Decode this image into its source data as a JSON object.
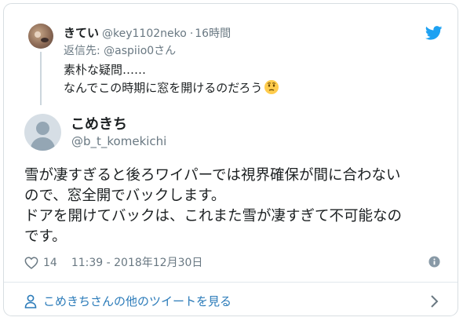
{
  "parent_tweet": {
    "name": "きてい",
    "handle": "@key1102neko",
    "separator": "·",
    "time": "16時間",
    "reply_to_label": "返信先: ",
    "reply_to_handle": "@aspiio0さん",
    "text_lines": [
      "素朴な疑問……",
      "なんでこの時期に窓を開けるのだろう"
    ],
    "emoji": "thinking-face-emoji"
  },
  "main_tweet": {
    "name": "こめきち",
    "handle": "@b_t_komekichi",
    "text_lines": [
      "雪が凄すぎると後ろワイパーでは視界確保が間に合わない",
      "ので、窓全開でバックします。",
      "ドアを開けてバックは、これまた雪が凄すぎて不可能なの",
      "です。"
    ],
    "likes": "14",
    "timestamp": "11:39 - 2018年12月30日"
  },
  "footer": {
    "more_link": "こめきちさんの他のツイートを見る"
  },
  "colors": {
    "twitter_blue": "#1da1f2",
    "link_blue": "#2b7bb9",
    "secondary_text": "#697882"
  },
  "icons": [
    "twitter-bird-icon",
    "heart-icon",
    "info-icon",
    "person-icon",
    "chevron-right-icon"
  ]
}
